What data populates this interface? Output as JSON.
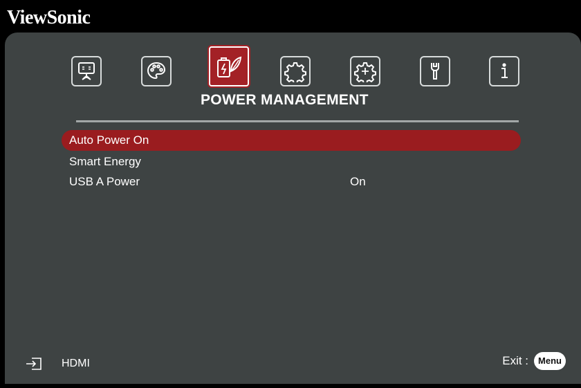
{
  "brand": "ViewSonic",
  "tabs": [
    {
      "icon": "display-icon"
    },
    {
      "icon": "palette-icon"
    },
    {
      "icon": "power-leaf-icon",
      "active": true
    },
    {
      "icon": "gear-icon"
    },
    {
      "icon": "advanced-gear-icon"
    },
    {
      "icon": "wrench-icon"
    },
    {
      "icon": "info-icon"
    }
  ],
  "section_title": "POWER MANAGEMENT",
  "menu_items": [
    {
      "label": "Auto Power On",
      "value": "",
      "selected": true
    },
    {
      "label": "Smart Energy",
      "value": ""
    },
    {
      "label": "USB A Power",
      "value": "On"
    }
  ],
  "footer": {
    "input_source": "HDMI",
    "exit_label": "Exit :",
    "menu_button": "Menu"
  },
  "colors": {
    "panel": "#3e4343",
    "highlight": "#9a1c1f",
    "active_tab": "#a32126"
  }
}
